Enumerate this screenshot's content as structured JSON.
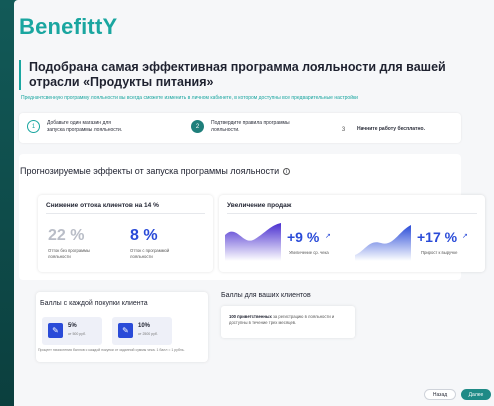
{
  "brand": {
    "logo": "BenefittY"
  },
  "header": {
    "title": "Подобрана самая эффективная программа лояльности для вашей отрасли «Продукты питания»",
    "subtitle": "Предначтсвенную программу лояльности вы всегда сможете изменить в личном кабинете, в котором доступны все предварительные настройки"
  },
  "steps": [
    {
      "num": "1",
      "label": "Добавьте один магазин для запуска программы лояльности."
    },
    {
      "num": "2",
      "label": "Подтвердите правила программы лояльности."
    },
    {
      "num": "3",
      "label": "Начните работу бесплатно."
    }
  ],
  "effects": {
    "title": "Прогнозируемые эффекты от запуска программы лояльности",
    "info_icon": "info-icon",
    "churn": {
      "title": "Снижение оттока клиентов на 14 %",
      "without_value": "22 %",
      "without_label": "Отток без программы лояльности",
      "with_value": "8 %",
      "with_label": "Отток с программой лояльности"
    },
    "sales": {
      "title": "Увеличение продаж",
      "avg_check_value": "+9 %",
      "avg_check_label": "Увеличение ср. чека",
      "revenue_value": "+17 %",
      "revenue_label": "Прирост к выручке"
    }
  },
  "points": {
    "title": "Баллы с каждой покупки клиента",
    "tiles": [
      {
        "value": "5%",
        "sub": "от 500 руб."
      },
      {
        "value": "10%",
        "sub": "от 2500 руб."
      }
    ],
    "note": "Процент начисления баллов с каждой покупки от заданной суммы чека. 1 балл = 1 рубль."
  },
  "clients": {
    "title": "Баллы для ваших клиентов",
    "bold": "100 приветственных",
    "text": " за регистрацию в лояльности и доступны в течение трех месяцев."
  },
  "footer": {
    "back_label": "Назад",
    "next_label": "Далее"
  },
  "colors": {
    "accent": "#1aa6a0",
    "blue": "#2a4bd8",
    "button": "#1f8a86"
  }
}
